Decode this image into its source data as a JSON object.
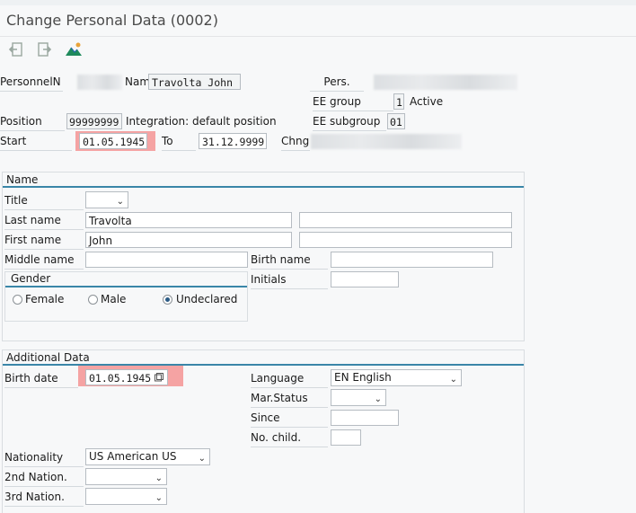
{
  "window": {
    "title": "Change Personal Data (0002)"
  },
  "toolbar": {
    "back_icon": "back-icon",
    "forward_icon": "forward-icon",
    "overview_icon": "overview-icon"
  },
  "header": {
    "personnel_label": "PersonnelN",
    "name_label": "Nam",
    "name_value": "Travolta John",
    "pers_label": "Pers.",
    "ee_group_label": "EE group",
    "ee_group_value": "1",
    "ee_group_text": "Active",
    "position_label": "Position",
    "position_value": "99999999",
    "position_text": "Integration: default position",
    "ee_subgroup_label": "EE subgroup",
    "ee_subgroup_value": "01",
    "start_label": "Start",
    "start_value": "01.05.1945",
    "to_label": "To",
    "to_value": "31.12.9999",
    "chng_label": "Chng"
  },
  "name_section": {
    "title": "Name",
    "title_label": "Title",
    "title_value": "",
    "last_name_label": "Last name",
    "last_name_value": "Travolta",
    "first_name_label": "First name",
    "first_name_value": "John",
    "middle_name_label": "Middle name",
    "birth_name_label": "Birth name",
    "initials_label": "Initials",
    "gender": {
      "title": "Gender",
      "options": [
        "Female",
        "Male",
        "Undeclared"
      ],
      "selected": "Undeclared"
    }
  },
  "additional_section": {
    "title": "Additional Data",
    "birth_date_label": "Birth date",
    "birth_date_value": "01.05.1945",
    "language_label": "Language",
    "language_value": "EN English",
    "mar_status_label": "Mar.Status",
    "since_label": "Since",
    "no_child_label": "No. child.",
    "nationality_label": "Nationality",
    "nationality_value": "US American US",
    "nation2_label": "2nd Nation.",
    "nation3_label": "3rd Nation."
  },
  "colors": {
    "accent": "#3a86a8",
    "highlight": "#f5a3a3"
  }
}
